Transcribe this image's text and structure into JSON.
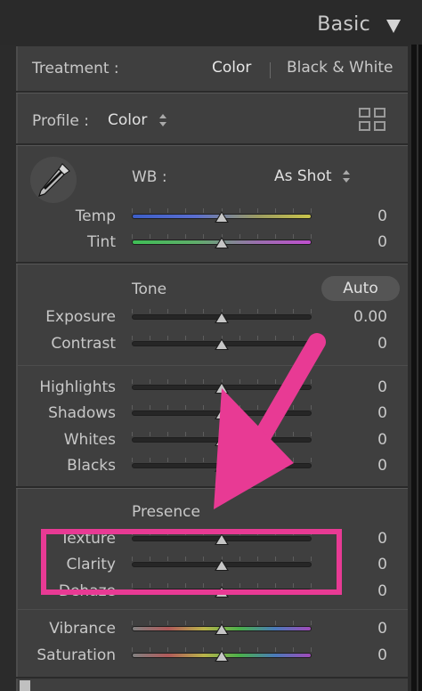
{
  "header": {
    "title": "Basic"
  },
  "treatment": {
    "label": "Treatment :",
    "option_color": "Color",
    "option_bw": "Black & White"
  },
  "profile": {
    "label": "Profile :",
    "value": "Color"
  },
  "wb": {
    "label": "WB :",
    "value": "As Shot"
  },
  "tone": {
    "title": "Tone",
    "auto_label": "Auto"
  },
  "presence": {
    "title": "Presence"
  },
  "sliders": {
    "temp": {
      "label": "Temp",
      "value": "0",
      "position": 0.5
    },
    "tint": {
      "label": "Tint",
      "value": "0",
      "position": 0.5
    },
    "exposure": {
      "label": "Exposure",
      "value": "0.00",
      "position": 0.5
    },
    "contrast": {
      "label": "Contrast",
      "value": "0",
      "position": 0.5
    },
    "highlights": {
      "label": "Highlights",
      "value": "0",
      "position": 0.5
    },
    "shadows": {
      "label": "Shadows",
      "value": "0",
      "position": 0.5
    },
    "whites": {
      "label": "Whites",
      "value": "0",
      "position": 0.5
    },
    "blacks": {
      "label": "Blacks",
      "value": "0",
      "position": 0.5
    },
    "texture": {
      "label": "Texture",
      "value": "0",
      "position": 0.5
    },
    "clarity": {
      "label": "Clarity",
      "value": "0",
      "position": 0.5
    },
    "dehaze": {
      "label": "Dehaze",
      "value": "0",
      "position": 0.5
    },
    "vibrance": {
      "label": "Vibrance",
      "value": "0",
      "position": 0.5
    },
    "saturation": {
      "label": "Saturation",
      "value": "0",
      "position": 0.5
    }
  },
  "colors": {
    "annotation": "#e83a94"
  }
}
